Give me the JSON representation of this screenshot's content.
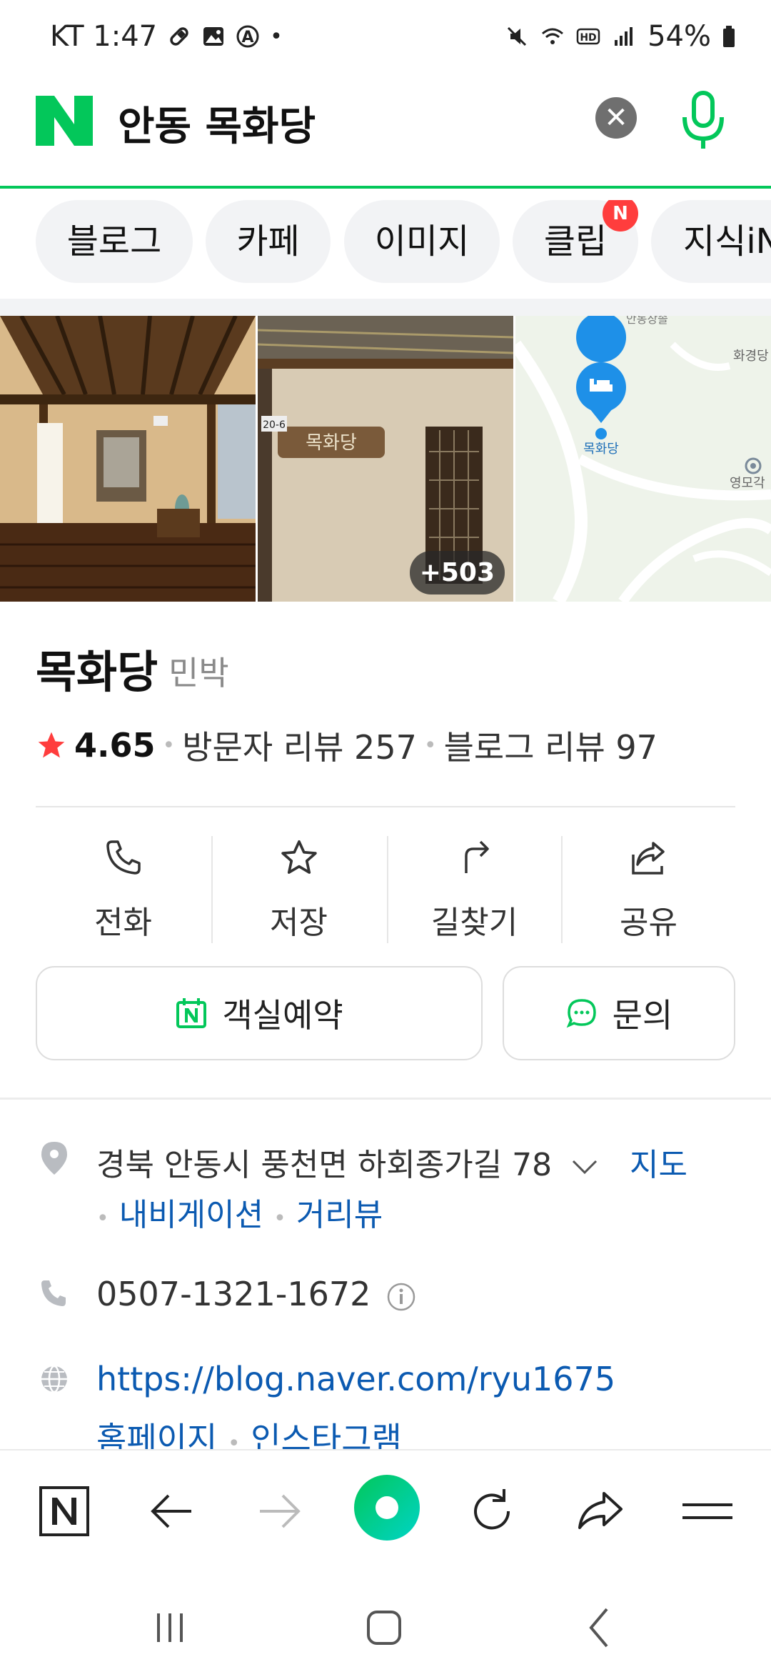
{
  "status": {
    "carrier_time": "KT 1:47",
    "battery": "54%"
  },
  "search": {
    "query": "안동 목화당"
  },
  "tabs": [
    {
      "label": "블로그"
    },
    {
      "label": "카페"
    },
    {
      "label": "이미지"
    },
    {
      "label": "클립",
      "badge": "N"
    },
    {
      "label": "지식iN"
    }
  ],
  "photos": {
    "more_count": "+503",
    "map": {
      "marker_label": "목화당",
      "place1": "화경당",
      "place2": "영모각",
      "place3": "안동장솔"
    },
    "sign": {
      "number": "20-6",
      "name": "목화당"
    }
  },
  "place": {
    "name": "목화당",
    "category": "민박",
    "rating": "4.65",
    "visitor_reviews": "방문자 리뷰 257",
    "blog_reviews": "블로그 리뷰 97"
  },
  "actions": [
    {
      "label": "전화",
      "icon": "phone-icon"
    },
    {
      "label": "저장",
      "icon": "star-icon"
    },
    {
      "label": "길찾기",
      "icon": "directions-icon"
    },
    {
      "label": "공유",
      "icon": "share-icon"
    }
  ],
  "buttons": {
    "reserve": "객실예약",
    "inquiry": "문의"
  },
  "info": {
    "address": "경북 안동시 풍천면 하회종가길 78",
    "map_link": "지도",
    "navigation_link": "내비게이션",
    "streetview_link": "거리뷰",
    "phone": "0507-1321-1672",
    "url": "https://blog.naver.com/ryu1675",
    "homepage_link": "홈페이지",
    "instagram_link": "인스타그램"
  },
  "colors": {
    "brand_green": "#03c75a",
    "link_blue": "#0b5ab1",
    "star_red": "#ff3d3d"
  }
}
